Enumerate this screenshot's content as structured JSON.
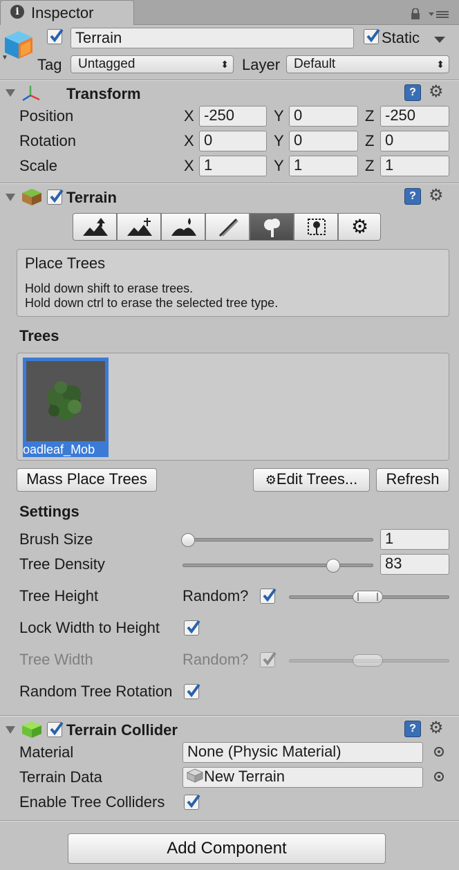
{
  "window": {
    "tab_title": "Inspector"
  },
  "object": {
    "name": "Terrain",
    "static_label": "Static",
    "tag_label": "Tag",
    "tag_value": "Untagged",
    "layer_label": "Layer",
    "layer_value": "Default"
  },
  "transform": {
    "title": "Transform",
    "position": {
      "label": "Position",
      "x": "-250",
      "y": "0",
      "z": "-250"
    },
    "rotation": {
      "label": "Rotation",
      "x": "0",
      "y": "0",
      "z": "0"
    },
    "scale": {
      "label": "Scale",
      "x": "1",
      "y": "1",
      "z": "1"
    },
    "axis": {
      "x": "X",
      "y": "Y",
      "z": "Z"
    }
  },
  "terrain": {
    "title": "Terrain",
    "tools": [
      "raise-lower-icon",
      "paint-height-icon",
      "smooth-height-icon",
      "paint-texture-icon",
      "place-trees-icon",
      "paint-details-icon",
      "settings-icon"
    ],
    "selected_tool": "place-trees-icon",
    "help_title": "Place Trees",
    "help_line1": "Hold down shift to erase trees.",
    "help_line2": "Hold down ctrl to erase the selected tree type.",
    "trees_label": "Trees",
    "tree_item_label": "oadleaf_Mob",
    "mass_place_label": "Mass Place Trees",
    "edit_trees_label": "Edit Trees...",
    "refresh_label": "Refresh",
    "settings_label": "Settings",
    "brush_size": {
      "label": "Brush Size",
      "value": "1",
      "fraction": 0.0
    },
    "tree_density": {
      "label": "Tree Density",
      "value": "83",
      "fraction": 0.83
    },
    "tree_height": {
      "label": "Tree Height",
      "random_label": "Random?"
    },
    "lock_width": {
      "label": "Lock Width to Height"
    },
    "tree_width": {
      "label": "Tree Width",
      "random_label": "Random?"
    },
    "random_rotation": {
      "label": "Random Tree Rotation"
    }
  },
  "collider": {
    "title": "Terrain Collider",
    "material_label": "Material",
    "material_value": "None (Physic Material)",
    "terrain_data_label": "Terrain Data",
    "terrain_data_value": "New Terrain",
    "enable_tree_label": "Enable Tree Colliders"
  },
  "add_component_label": "Add Component",
  "colors": {
    "selection_blue": "#3b7bd6",
    "panel_bg": "#c2c2c2",
    "help_icon": "#3a6fb5"
  }
}
